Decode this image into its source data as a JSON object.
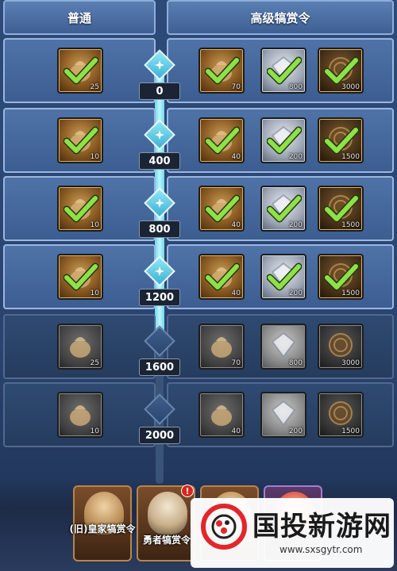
{
  "header": {
    "left_tab": "普通",
    "right_tab": "高级犒赏令"
  },
  "rows": [
    {
      "level": "0",
      "locked": false,
      "free": {
        "qty": "25",
        "claimed": true
      },
      "premium": [
        {
          "kind": "bag",
          "qty": "70",
          "claimed": true
        },
        {
          "kind": "gem",
          "qty": "800",
          "claimed": true
        },
        {
          "kind": "coin",
          "qty": "3000",
          "claimed": true
        }
      ]
    },
    {
      "level": "400",
      "locked": false,
      "free": {
        "qty": "10",
        "claimed": true
      },
      "premium": [
        {
          "kind": "bag",
          "qty": "40",
          "claimed": true
        },
        {
          "kind": "gem",
          "qty": "200",
          "claimed": true
        },
        {
          "kind": "coin",
          "qty": "1500",
          "claimed": true
        }
      ]
    },
    {
      "level": "800",
      "locked": false,
      "free": {
        "qty": "10",
        "claimed": true
      },
      "premium": [
        {
          "kind": "bag",
          "qty": "40",
          "claimed": true
        },
        {
          "kind": "gem",
          "qty": "200",
          "claimed": true
        },
        {
          "kind": "coin",
          "qty": "1500",
          "claimed": true
        }
      ]
    },
    {
      "level": "1200",
      "locked": false,
      "free": {
        "qty": "10",
        "claimed": true
      },
      "premium": [
        {
          "kind": "bag",
          "qty": "40",
          "claimed": true
        },
        {
          "kind": "gem",
          "qty": "200",
          "claimed": true
        },
        {
          "kind": "coin",
          "qty": "1500",
          "claimed": true
        }
      ]
    },
    {
      "level": "1600",
      "locked": true,
      "free": {
        "qty": "25",
        "claimed": false
      },
      "premium": [
        {
          "kind": "bag",
          "qty": "70",
          "claimed": false
        },
        {
          "kind": "gem",
          "qty": "800",
          "claimed": false
        },
        {
          "kind": "coin",
          "qty": "3000",
          "claimed": false
        }
      ]
    },
    {
      "level": "2000",
      "locked": true,
      "free": {
        "qty": "10",
        "claimed": false
      },
      "premium": [
        {
          "kind": "bag",
          "qty": "40",
          "claimed": false
        },
        {
          "kind": "gem",
          "qty": "200",
          "claimed": false
        },
        {
          "kind": "coin",
          "qty": "1500",
          "claimed": false
        }
      ]
    }
  ],
  "bottom_tabs": [
    {
      "label": "(旧)皇家犒赏令",
      "alert": false
    },
    {
      "label": "勇者犒赏令",
      "alert": true,
      "alert_text": "!"
    }
  ],
  "watermark": {
    "brand": "国投新游网",
    "url": "www.sxsgytr.com"
  },
  "colors": {
    "check": "#8fe04a",
    "spine_active": "#6fd9e8",
    "panel": "#4f73a8"
  }
}
